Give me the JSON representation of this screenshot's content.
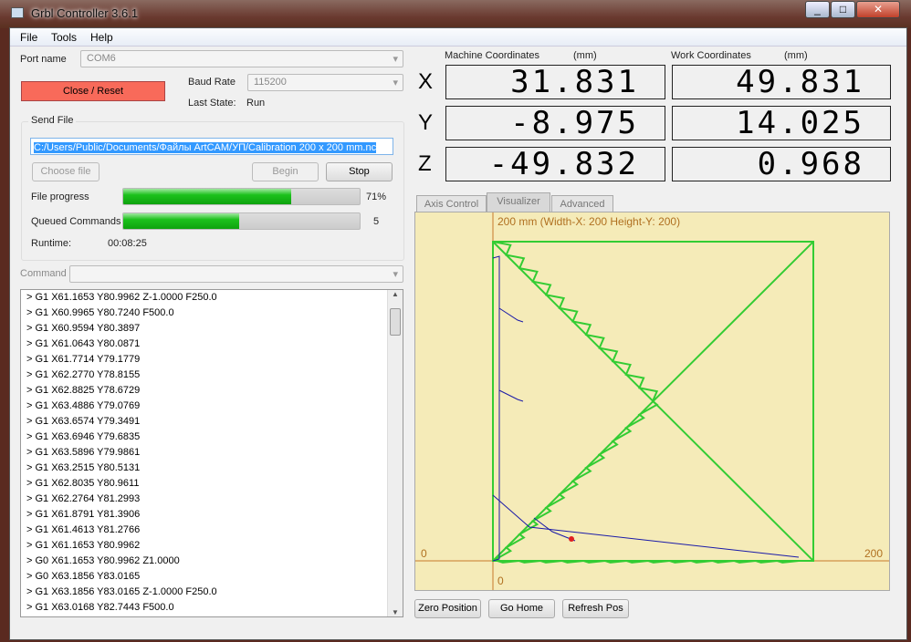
{
  "window": {
    "title": "Grbl Controller 3.6.1",
    "controls": [
      "_",
      "□",
      "✕"
    ]
  },
  "menu": [
    "File",
    "Tools",
    "Help"
  ],
  "connection": {
    "port_label": "Port name",
    "port_value": "COM6",
    "close_button": "Close / Reset",
    "baud_label": "Baud Rate",
    "baud_value": "115200",
    "state_label": "Last State:",
    "state_value": "Run"
  },
  "send_file": {
    "group_label": "Send File",
    "path": "C:/Users/Public/Documents/Файлы ArtCAM/УП/Calibration 200 x 200 mm.nc",
    "choose_button": "Choose file",
    "begin_button": "Begin",
    "stop_button": "Stop",
    "file_progress_label": "File progress",
    "file_progress_value": "71%",
    "file_progress": 71,
    "queued_label": "Queued Commands",
    "queued_value": "5",
    "queued_fill_percent": 49,
    "runtime_label": "Runtime:",
    "runtime_value": "00:08:25"
  },
  "command": {
    "label": "Command",
    "value": ""
  },
  "log": [
    "> G1 X61.1653 Y80.9962 Z-1.0000 F250.0",
    "> G1 X60.9965 Y80.7240  F500.0",
    "> G1 X60.9594 Y80.3897",
    "> G1 X61.0643 Y80.0871",
    "> G1 X61.7714 Y79.1779",
    "> G1 X62.2770 Y78.8155",
    "> G1 X62.8825 Y78.6729",
    "> G1 X63.4886 Y79.0769",
    "> G1 X63.6574 Y79.3491",
    "> G1 X63.6946 Y79.6835",
    "> G1 X63.5896 Y79.9861",
    "> G1 X63.2515 Y80.5131",
    "> G1 X62.8035 Y80.9611",
    "> G1 X62.2764 Y81.2993",
    "> G1 X61.8791 Y81.3906",
    "> G1 X61.4613 Y81.2766",
    "> G1 X61.1653 Y80.9962",
    "> G0 X61.1653 Y80.9962 Z1.0000",
    "> G0 X63.1856 Y83.0165",
    "> G1 X63.1856 Y83.0165 Z-1.0000 F250.0",
    "> G1 X63.0168 Y82.7443  F500.0"
  ],
  "coords": {
    "machine_label": "Machine Coordinates",
    "work_label": "Work Coordinates",
    "unit": "(mm)",
    "axes": [
      "X",
      "Y",
      "Z"
    ],
    "machine": [
      "31.831",
      "-8.975",
      "-49.832"
    ],
    "work": [
      "49.831",
      "14.025",
      "0.968"
    ]
  },
  "tabs": [
    "Axis Control",
    "Visualizer",
    "Advanced"
  ],
  "active_tab": "Visualizer",
  "visualizer": {
    "header": "200 mm  (Width-X: 200  Height-Y: 200)",
    "x_min": "0",
    "x_max": "200",
    "y_min": "0",
    "colors": {
      "background": "#f5ebb8",
      "axis": "#c87a2a",
      "cut": "#33cc33",
      "rapid": "#1a1aa8"
    }
  },
  "bottom_buttons": [
    "Zero Position",
    "Go Home",
    "Refresh Pos"
  ]
}
